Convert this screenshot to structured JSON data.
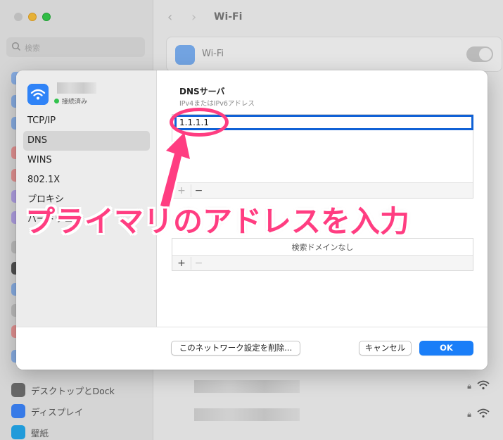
{
  "background": {
    "window_title": "Wi-Fi",
    "search_placeholder": "検索",
    "wifi_row_label": "Wi-Fi",
    "sidebar_items": [
      {
        "label": "デスクトップとDock",
        "icon": "dock-icon",
        "color": "#6e6e6e"
      },
      {
        "label": "ディスプレイ",
        "icon": "display-icon",
        "color": "#3b82f6"
      },
      {
        "label": "壁紙",
        "icon": "wallpaper-icon",
        "color": "#22a5e8"
      }
    ]
  },
  "sheet": {
    "network_status": "接続済み",
    "sidebar_items": [
      "TCP/IP",
      "DNS",
      "WINS",
      "802.1X",
      "プロキシ",
      "ハードウェア"
    ],
    "selected_item": "DNS",
    "dns_section_title": "DNSサーバ",
    "dns_section_subtitle": "IPv4またはIPv6アドレス",
    "dns_input_value": "1.1.1.1",
    "search_domain_empty": "検索ドメインなし",
    "add_symbol": "+",
    "remove_symbol": "−",
    "delete_button": "このネットワーク設定を削除...",
    "cancel_button": "キャンセル",
    "ok_button": "OK"
  },
  "annotation": {
    "text": "プライマリのアドレスを入力",
    "color": "#ff3d81"
  },
  "colors": {
    "accent": "#1a7ef8",
    "status_green": "#32c24d",
    "focus_ring": "#1061d6"
  }
}
